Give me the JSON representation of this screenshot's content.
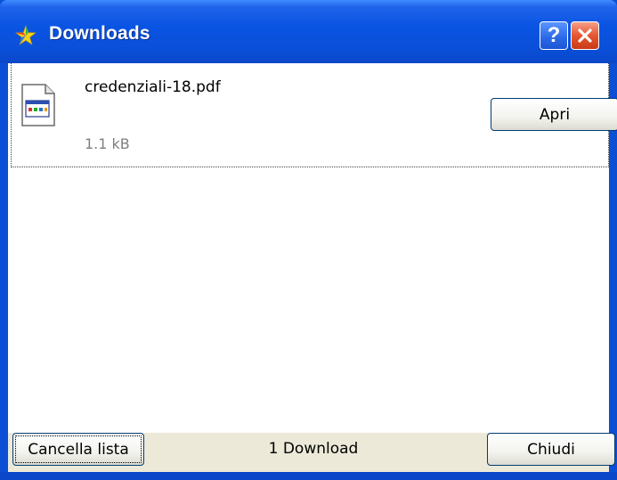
{
  "window": {
    "title": "Downloads",
    "title_icon": "downloads-star-icon",
    "help_label": "?",
    "close_icon": "close-x-icon",
    "colors": {
      "titlebar": "#0a54e3",
      "close": "#e6552f",
      "frame": "#0a4fd6"
    }
  },
  "downloads": [
    {
      "file_name": "credenziali-18.pdf",
      "size": "1.1 kB",
      "icon": "file-document-icon",
      "action_label": "Apri"
    }
  ],
  "footer": {
    "clear_label": "Cancella lista",
    "status": "1 Download",
    "close_label": "Chiudi"
  }
}
